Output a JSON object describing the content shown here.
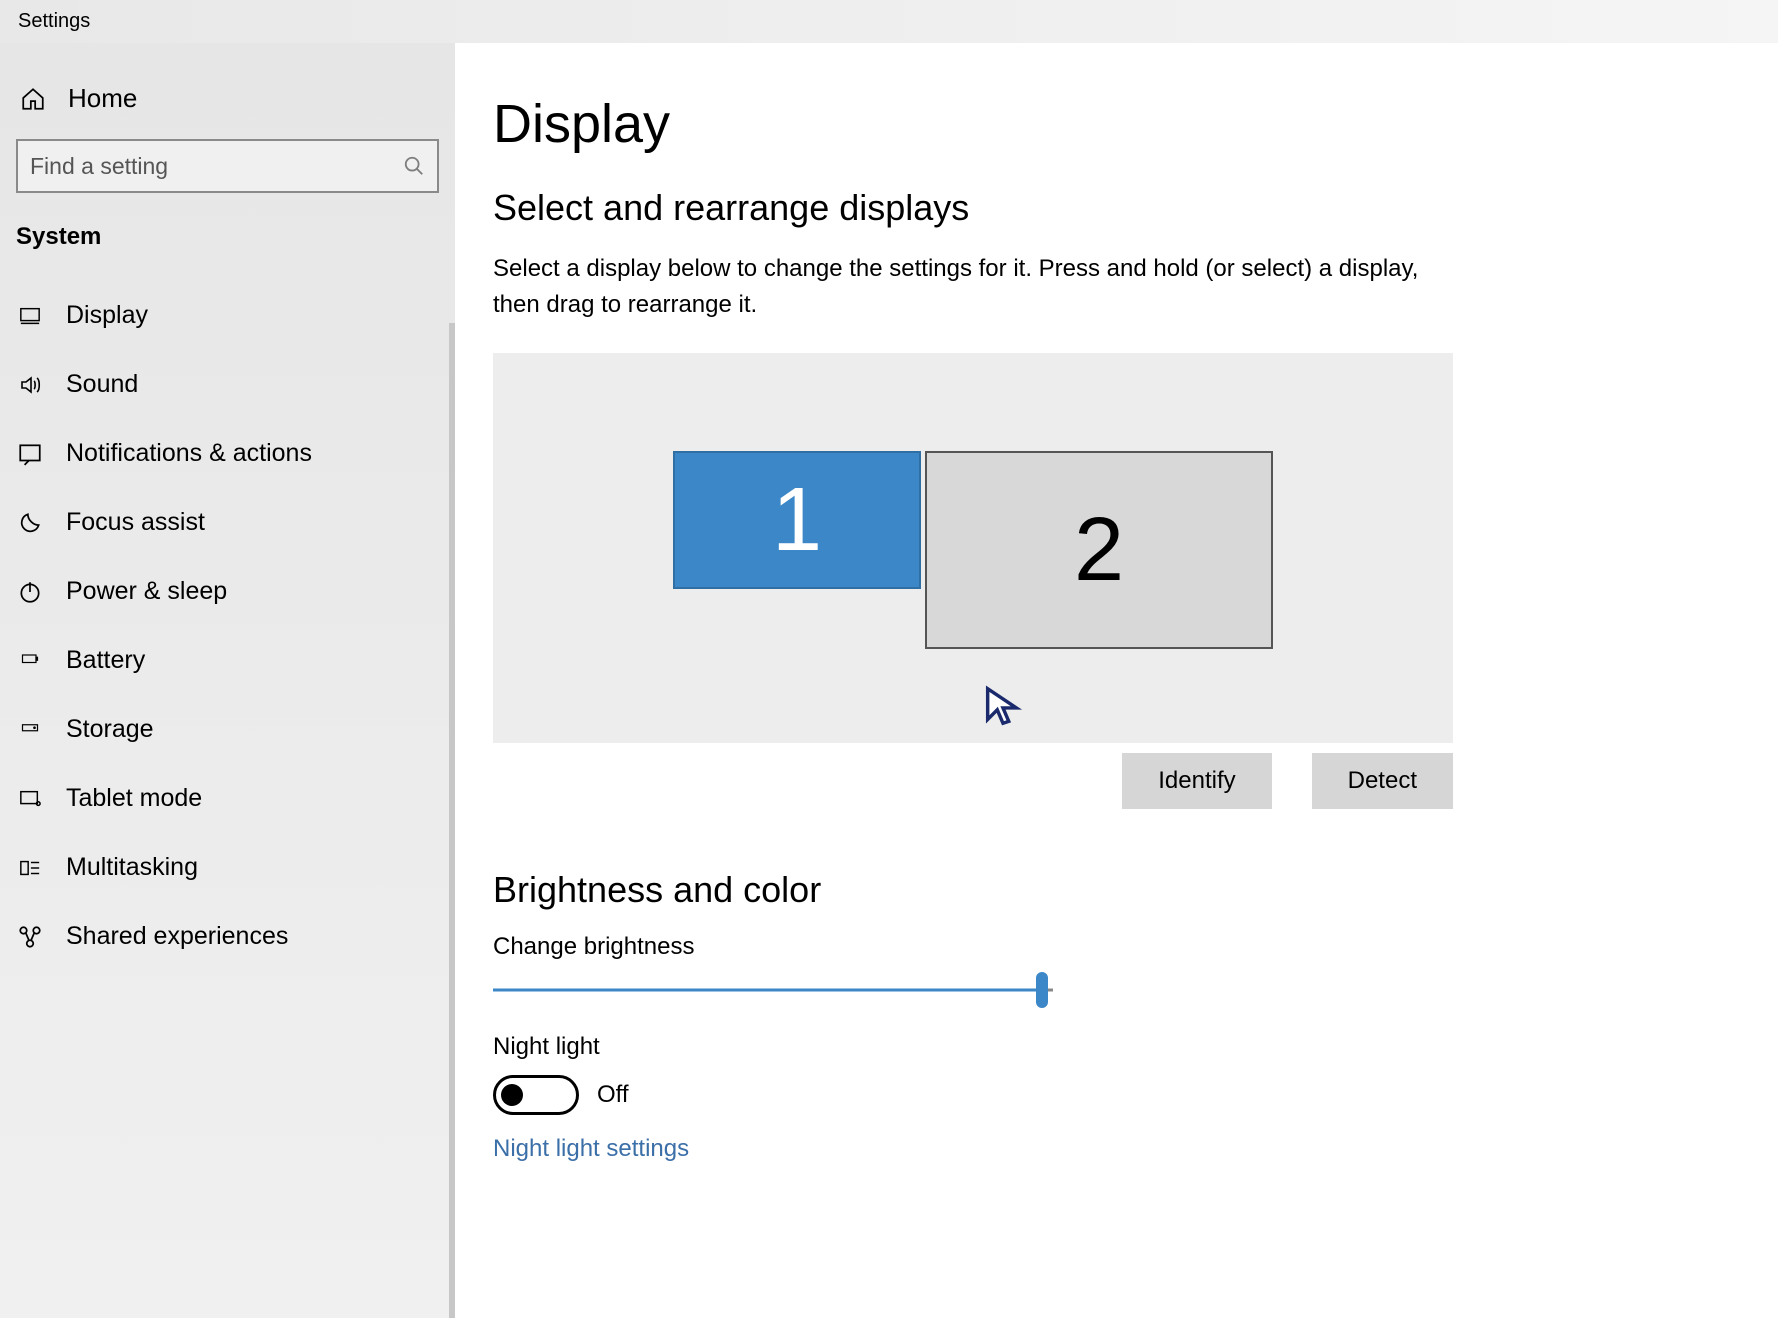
{
  "window_title": "Settings",
  "sidebar": {
    "home_label": "Home",
    "search_placeholder": "Find a setting",
    "section_label": "System",
    "items": [
      {
        "id": "display",
        "label": "Display"
      },
      {
        "id": "sound",
        "label": "Sound"
      },
      {
        "id": "notifications",
        "label": "Notifications & actions"
      },
      {
        "id": "focus-assist",
        "label": "Focus assist"
      },
      {
        "id": "power-sleep",
        "label": "Power & sleep"
      },
      {
        "id": "battery",
        "label": "Battery"
      },
      {
        "id": "storage",
        "label": "Storage"
      },
      {
        "id": "tablet-mode",
        "label": "Tablet mode"
      },
      {
        "id": "multitasking",
        "label": "Multitasking"
      },
      {
        "id": "shared-experiences",
        "label": "Shared experiences"
      }
    ]
  },
  "main": {
    "title": "Display",
    "arrange": {
      "heading": "Select and rearrange displays",
      "description": "Select a display below to change the settings for it. Press and hold (or select) a display, then drag to rearrange it.",
      "monitors": {
        "m1": "1",
        "m2": "2"
      },
      "identify_label": "Identify",
      "detect_label": "Detect"
    },
    "brightness": {
      "heading": "Brightness and color",
      "slider_label": "Change brightness",
      "slider_percent": 98,
      "night_light_label": "Night light",
      "night_light_state": "Off",
      "night_light_settings_link": "Night light settings"
    }
  }
}
